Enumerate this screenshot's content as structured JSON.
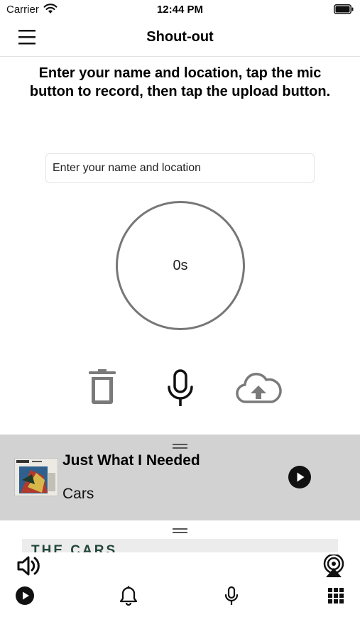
{
  "status_bar": {
    "carrier": "Carrier",
    "time": "12:44 PM"
  },
  "nav": {
    "title": "Shout-out",
    "menu_icon": "hamburger-menu-icon"
  },
  "instructions": "Enter your name and location, tap the mic button to record, then tap the upload button.",
  "name_input": {
    "placeholder": "Enter your name and location",
    "value": ""
  },
  "timer": {
    "text": "0s"
  },
  "controls": {
    "icons": [
      "trash-icon",
      "microphone-icon",
      "cloud-upload-icon"
    ]
  },
  "now_playing": {
    "title": "Just What I Needed",
    "artist": "Cars",
    "play_icon": "play-circle-icon"
  },
  "second_banner": {
    "text": "THE CARS"
  },
  "bottom_bar": {
    "icons": [
      "volume-icon",
      "airplay-icon"
    ],
    "tabs": [
      "play-circle-icon",
      "bell-icon",
      "microphone-icon",
      "grid-icon"
    ]
  },
  "colors": {
    "now_playing_bg": "#d2d2d2",
    "icon_gray": "#777777",
    "text": "#000000"
  }
}
